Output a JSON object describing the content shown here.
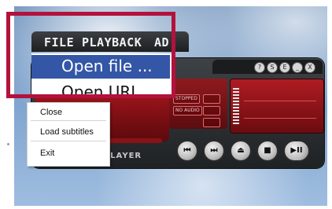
{
  "menubar": {
    "items": [
      "FILE",
      "PLAYBACK",
      "AD"
    ]
  },
  "file_menu": {
    "items": [
      "Open file ...",
      "Open URL"
    ]
  },
  "context_menu": {
    "items": [
      "Close",
      "Load subtitles",
      "Exit"
    ]
  },
  "player": {
    "brand_text": "H PLAYER",
    "display_tags": [
      "STOPPED",
      "NO AUDIO"
    ],
    "window_buttons": [
      "?",
      "S",
      "E",
      "_",
      "X"
    ],
    "controls": [
      "⏮",
      "⏭",
      "⏏",
      "■",
      "▶II"
    ]
  },
  "colors": {
    "highlight_box": "#b3123c",
    "menu_selection": "#3356a6",
    "player_red": "#9c1419"
  }
}
